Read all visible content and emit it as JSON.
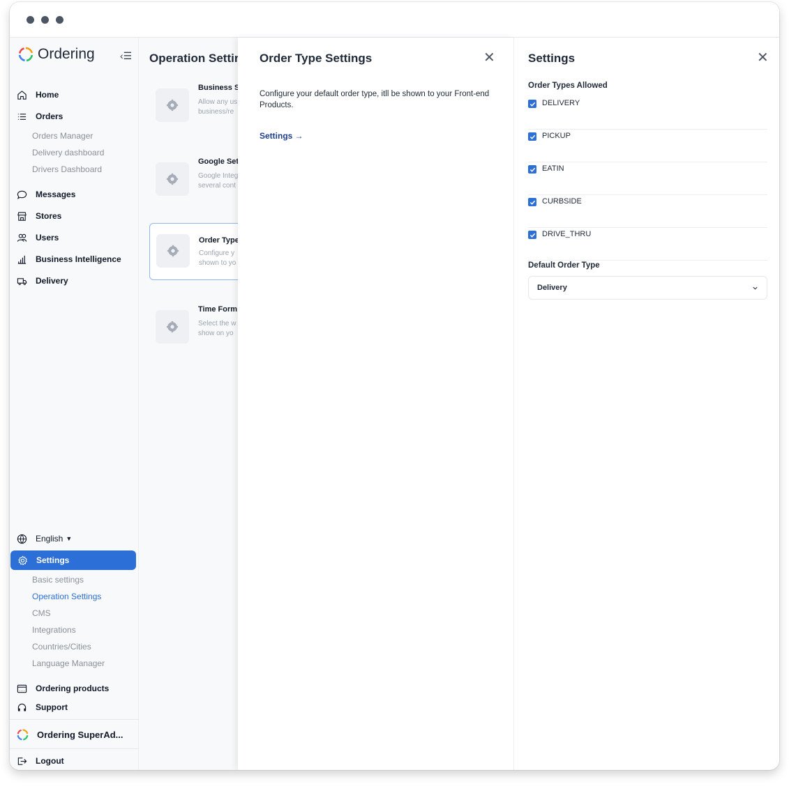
{
  "sidebar": {
    "brand": "Ordering",
    "items": [
      {
        "label": "Home",
        "icon": "home-icon"
      },
      {
        "label": "Orders",
        "icon": "list-icon"
      },
      {
        "label": "Messages",
        "icon": "chat-icon"
      },
      {
        "label": "Stores",
        "icon": "store-icon"
      },
      {
        "label": "Users",
        "icon": "users-icon"
      },
      {
        "label": "Business Intelligence",
        "icon": "bar-chart-icon"
      },
      {
        "label": "Delivery",
        "icon": "truck-icon"
      }
    ],
    "orders_sub": [
      "Orders Manager",
      "Delivery dashboard",
      "Drivers Dashboard"
    ],
    "language": "English",
    "settings": {
      "label": "Settings"
    },
    "settings_sub": [
      "Basic settings",
      "Operation Settings",
      "CMS",
      "Integrations",
      "Countries/Cities",
      "Language Manager"
    ],
    "ordering_products": "Ordering products",
    "support": "Support",
    "account": "Ordering SuperAd...",
    "logout": "Logout",
    "accent_color": "#2c6fd6"
  },
  "operation": {
    "title": "Operation Settir",
    "cards": [
      {
        "title": "Business Sl",
        "desc1": "Allow any us",
        "desc2": "business/re"
      },
      {
        "title": "Google Set",
        "desc1": "Google Integ",
        "desc2": "several cont"
      },
      {
        "title": "Order Type",
        "desc1": "Configure y",
        "desc2": "shown to yo"
      },
      {
        "title": "Time Form",
        "desc1": "Select the w",
        "desc2": "show on yo"
      }
    ]
  },
  "order_type_panel": {
    "title": "Order Type Settings",
    "description": "Configure your default order type, itll be shown to your Front-end Products.",
    "link": "Settings →"
  },
  "settings_panel": {
    "title": "Settings",
    "allowed_label": "Order Types Allowed",
    "types": [
      {
        "label": "DELIVERY",
        "checked": true
      },
      {
        "label": "PICKUP",
        "checked": true
      },
      {
        "label": "EATIN",
        "checked": true
      },
      {
        "label": "CURBSIDE",
        "checked": true
      },
      {
        "label": "DRIVE_THRU",
        "checked": true
      }
    ],
    "default_label": "Default Order Type",
    "default_value": "Delivery"
  }
}
